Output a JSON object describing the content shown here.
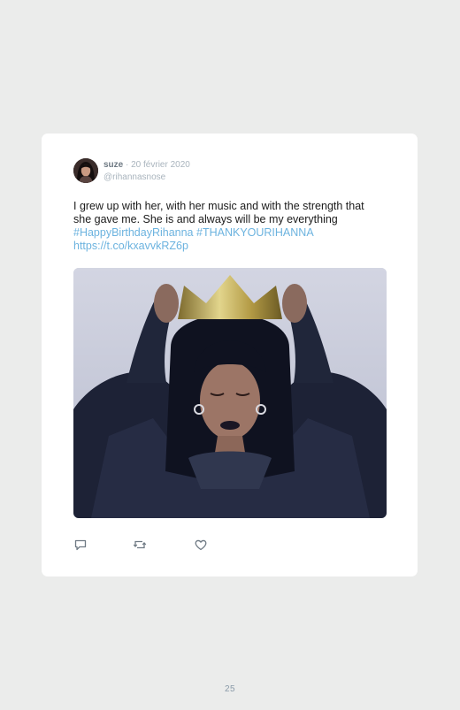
{
  "tweet": {
    "author_name": "suze",
    "separator": " · ",
    "date": "20 février 2020",
    "handle": "@rihannasnose",
    "text_line1": "I grew up with her, with her music and with the strength that",
    "text_line2": "she gave me. She is and always will be my everything",
    "hashtag1": "#HappyBirthdayRihanna",
    "hashtag2": "#THANKYOURIHANNA",
    "url": "https://t.co/kxavvkRZ6p",
    "media_icon": "photo-gif",
    "actions": [
      {
        "name": "reply",
        "icon": "speech-bubble-icon"
      },
      {
        "name": "retweet",
        "icon": "retweet-arrows-icon"
      },
      {
        "name": "like",
        "icon": "heart-icon"
      }
    ]
  },
  "page": {
    "number": "25"
  },
  "colors": {
    "background": "#ebeceb",
    "card": "#ffffff",
    "link": "#6cb3df",
    "muted": "#a9b4bd",
    "icon": "#6f7a84"
  }
}
